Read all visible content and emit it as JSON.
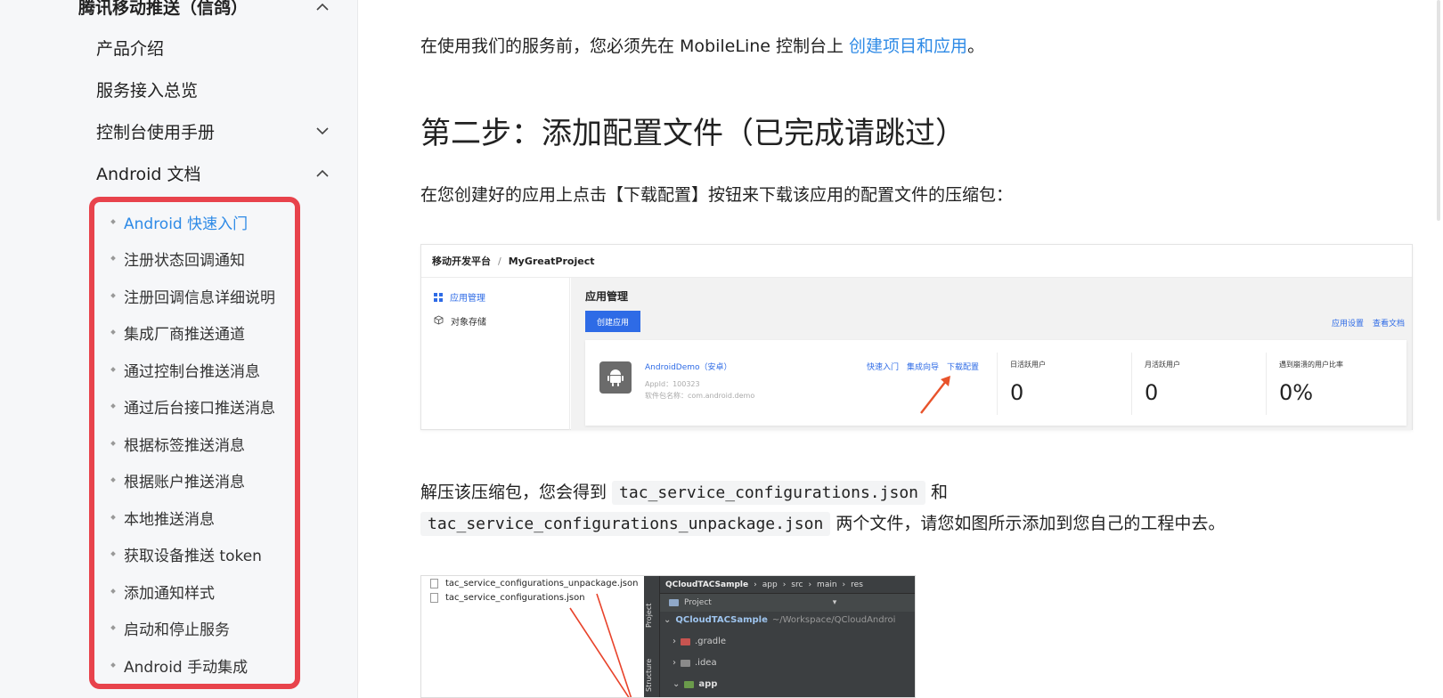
{
  "sidebar": {
    "section_title": "腾讯移动推送（信鸽）",
    "items": [
      {
        "label": "产品介绍"
      },
      {
        "label": "服务接入总览"
      },
      {
        "label": "控制台使用手册"
      },
      {
        "label": "Android 文档"
      }
    ],
    "sub_items": [
      {
        "label": "Android 快速入门",
        "active": true
      },
      {
        "label": "注册状态回调通知"
      },
      {
        "label": "注册回调信息详细说明"
      },
      {
        "label": "集成厂商推送通道"
      },
      {
        "label": "通过控制台推送消息"
      },
      {
        "label": "通过后台接口推送消息"
      },
      {
        "label": "根据标签推送消息"
      },
      {
        "label": "根据账户推送消息"
      },
      {
        "label": "本地推送消息"
      },
      {
        "label": "获取设备推送 token"
      },
      {
        "label": "添加通知样式"
      },
      {
        "label": "启动和停止服务"
      },
      {
        "label": "Android 手动集成"
      }
    ]
  },
  "main": {
    "intro_text": "在使用我们的服务前，您必须先在 MobileLine 控制台上 ",
    "intro_link": "创建项目和应用",
    "intro_end": "。",
    "step2_heading": "第二步：添加配置文件（已完成请跳过）",
    "step2_text": "在您创建好的应用上点击【下载配置】按钮来下载该应用的配置文件的压缩包：",
    "unzip_text_1": "解压该压缩包，您会得到 ",
    "unzip_code_1": "tac_service_configurations.json",
    "unzip_text_2": " 和",
    "unzip_code_2": "tac_service_configurations_unpackage.json",
    "unzip_text_3": " 两个文件，请您如图所示添加到您自己的工程中去。"
  },
  "console_shot": {
    "breadcrumb_root": "移动开发平台",
    "breadcrumb_sep": "/",
    "breadcrumb_project": "MyGreatProject",
    "nav_app_mgmt": "应用管理",
    "nav_storage": "对象存储",
    "page_title": "应用管理",
    "create_button": "创建应用",
    "link_app_settings": "应用设置",
    "link_view_docs": "查看文档",
    "app_name": "AndroidDemo（安卓）",
    "app_id": "AppId：100323",
    "app_package": "软件包名称：com.android.demo",
    "link_quick_start": "快速入门",
    "link_integration_guide": "集成向导",
    "link_download_config": "下载配置",
    "stats": [
      {
        "label": "日活跃用户",
        "value": "0"
      },
      {
        "label": "月活跃用户",
        "value": "0"
      },
      {
        "label": "遇到崩溃的用户比率",
        "value": "0%"
      }
    ]
  },
  "ide_shot": {
    "file_1": "tac_service_configurations_unpackage.json",
    "file_2": "tac_service_configurations.json",
    "tab_project": "Project",
    "tab_structure": "Structure",
    "breadcrumb": [
      "QCloudTACSample",
      "app",
      "src",
      "main",
      "res"
    ],
    "project_dropdown": "Project",
    "root_name": "QCloudTACSample",
    "root_path": "~/Workspace/QCloudAndroi",
    "rows": [
      ".gradle",
      ".idea",
      "app"
    ]
  },
  "colors": {
    "accent": "#2e8ae6",
    "highlight_border": "#e8434c",
    "console_blue": "#2e6be6"
  }
}
